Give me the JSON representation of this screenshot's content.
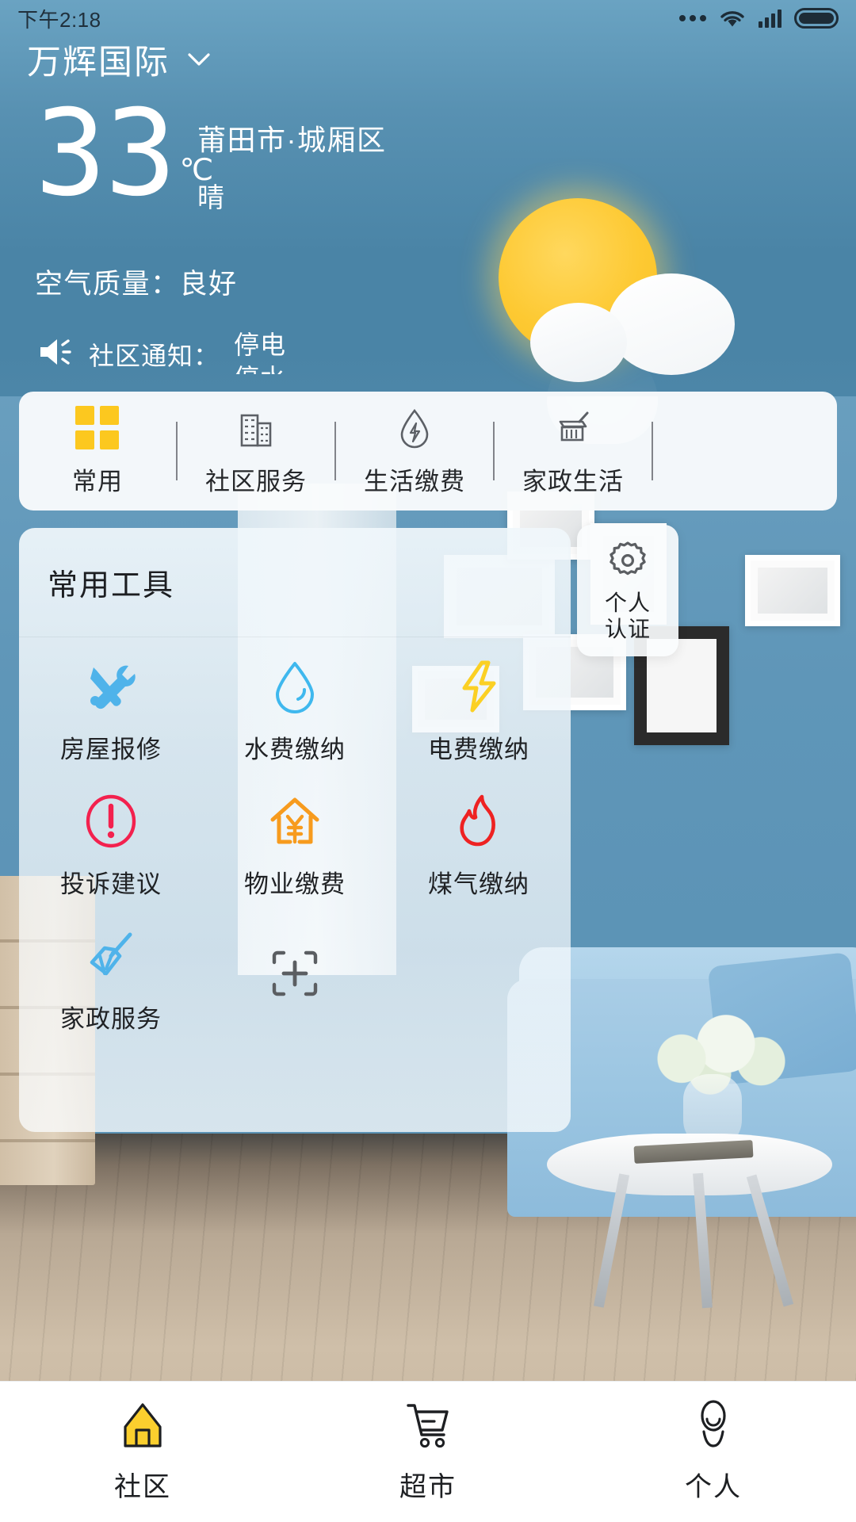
{
  "status_bar": {
    "time": "下午2:18",
    "icons": [
      "more-dots-icon",
      "wifi-icon",
      "signal-icon",
      "battery-icon"
    ]
  },
  "header": {
    "community_name": "万辉国际",
    "dropdown_icon": "chevron-down-icon"
  },
  "weather": {
    "temperature": "33",
    "unit": "℃",
    "location": "莆田市·城厢区",
    "condition": "晴",
    "air_quality": "空气质量：良好",
    "icon": "sun-behind-cloud-icon"
  },
  "notice": {
    "speaker_icon": "speaker-icon",
    "label": "社区通知：",
    "items": [
      "停电",
      "停水"
    ]
  },
  "categories": [
    {
      "label": "常用",
      "icon": "grid-icon",
      "active": true
    },
    {
      "label": "社区服务",
      "icon": "building-icon",
      "active": false
    },
    {
      "label": "生活缴费",
      "icon": "water-drop-bolt-icon",
      "active": false
    },
    {
      "label": "家政生活",
      "icon": "broom-icon",
      "active": false
    }
  ],
  "tools_card": {
    "title": "常用工具",
    "items": [
      {
        "label": "房屋报修",
        "icon": "wrench-screwdriver-icon",
        "color": "#4FB3EA"
      },
      {
        "label": "水费缴纳",
        "icon": "water-drop-icon",
        "color": "#3FB8EE"
      },
      {
        "label": "电费缴纳",
        "icon": "lightning-bolt-icon",
        "color": "#FBD024"
      },
      {
        "label": "投诉建议",
        "icon": "exclamation-circle-icon",
        "color": "#F3214E"
      },
      {
        "label": "物业缴费",
        "icon": "house-yuan-icon",
        "color": "#F79B1E"
      },
      {
        "label": "煤气缴纳",
        "icon": "flame-icon",
        "color": "#EE2222"
      },
      {
        "label": "家政服务",
        "icon": "duster-icon",
        "color": "#4FB3EA"
      },
      {
        "label": "",
        "icon": "add-scan-icon",
        "color": "#5B5E62"
      }
    ]
  },
  "auth_button": {
    "icon": "gear-icon",
    "line1": "个人",
    "line2": "认证"
  },
  "bottom_nav": [
    {
      "label": "社区",
      "icon": "home-icon",
      "active": true
    },
    {
      "label": "超市",
      "icon": "cart-icon",
      "active": false
    },
    {
      "label": "个人",
      "icon": "person-icon",
      "active": false
    }
  ],
  "colors": {
    "header_blue": "#4a84a6",
    "accent_yellow": "#fcc81f",
    "card_white": "#f9fbfc"
  }
}
